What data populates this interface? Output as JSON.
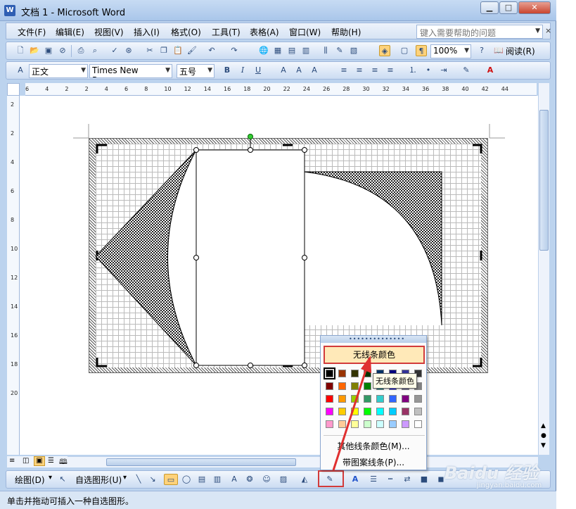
{
  "window": {
    "title": "文档 1 - Microsoft Word",
    "app_icon": "word-doc-icon",
    "minimize": "▁",
    "maximize": "□",
    "close": "✕"
  },
  "menu": {
    "items": [
      "文件(F)",
      "编辑(E)",
      "视图(V)",
      "插入(I)",
      "格式(O)",
      "工具(T)",
      "表格(A)",
      "窗口(W)",
      "帮助(H)"
    ],
    "help_placeholder": "键入需要帮助的问题",
    "close_doc": "×"
  },
  "standard_toolbar": {
    "zoom": "100%",
    "reading_label": "阅读(R)"
  },
  "format_toolbar": {
    "style": "正文",
    "font": "Times New Roman",
    "size": "五号",
    "bold": "B",
    "italic": "I",
    "underline": "U"
  },
  "ruler": {
    "horizontal": [
      "6",
      "4",
      "2",
      "2",
      "4",
      "6",
      "8",
      "10",
      "12",
      "14",
      "16",
      "18",
      "20",
      "22",
      "24",
      "26",
      "28",
      "30",
      "32",
      "34",
      "36",
      "38",
      "40",
      "42",
      "44"
    ],
    "vertical": [
      "2",
      "2",
      "4",
      "6",
      "8",
      "10",
      "12",
      "14",
      "16",
      "18",
      "20"
    ]
  },
  "line_color_popup": {
    "no_line_label": "无线条颜色",
    "tooltip": "无线条颜色",
    "more_colors": "其他线条颜色(M)...",
    "patterned_lines": "带图案线条(P)...",
    "colors": [
      "#000000",
      "#993300",
      "#333300",
      "#003300",
      "#003366",
      "#000080",
      "#333399",
      "#333333",
      "#800000",
      "#FF6600",
      "#808000",
      "#008000",
      "#008080",
      "#0000FF",
      "#666699",
      "#808080",
      "#FF0000",
      "#FF9900",
      "#99CC00",
      "#339966",
      "#33CCCC",
      "#3366FF",
      "#800080",
      "#969696",
      "#FF00FF",
      "#FFCC00",
      "#FFFF00",
      "#00FF00",
      "#00FFFF",
      "#00CCFF",
      "#993366",
      "#C0C0C0",
      "#FF99CC",
      "#FFCC99",
      "#FFFF99",
      "#CCFFCC",
      "#CCFFFF",
      "#99CCFF",
      "#CC99FF",
      "#FFFFFF"
    ],
    "selected_color": "#000000"
  },
  "drawing_toolbar": {
    "draw_label": "绘图(D)",
    "autoshapes_label": "自选图形(U)",
    "font_color_letter": "A"
  },
  "status": {
    "text": "单击并拖动可插入一种自选图形。"
  },
  "watermark": {
    "brand": "Baidu 经验",
    "url": "jingyan.baidu.com"
  },
  "colors": {
    "highlight": "#d23b3b",
    "accent": "#2f5fb3",
    "chrome": "#bcd3ee"
  }
}
